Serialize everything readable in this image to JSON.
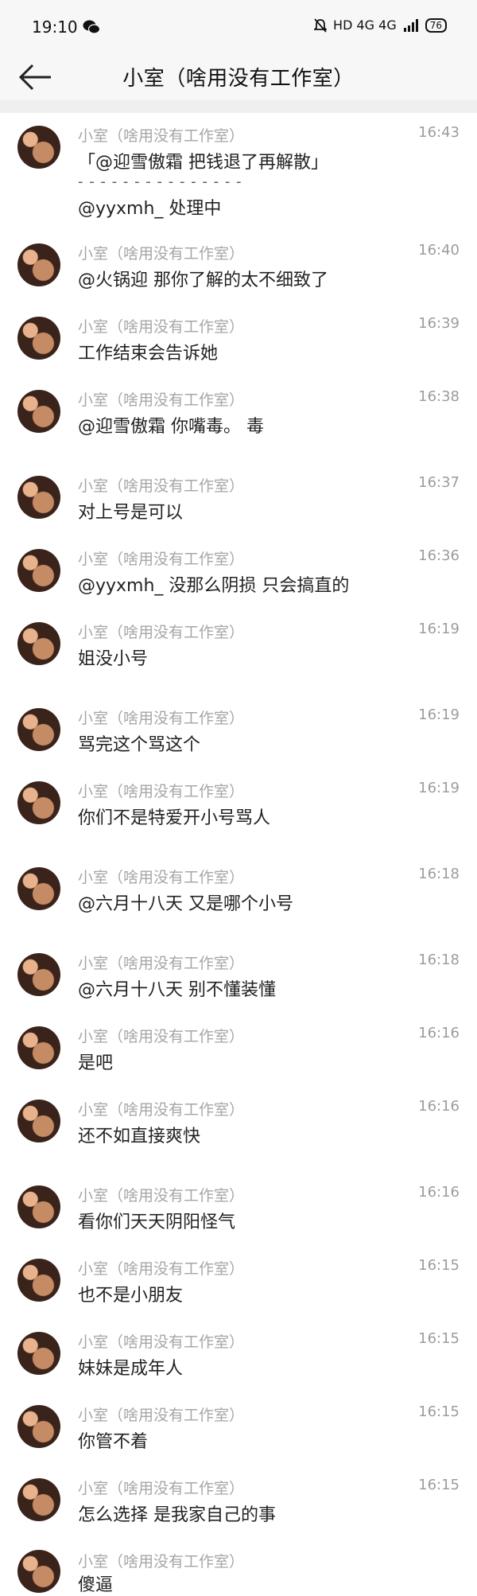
{
  "status": {
    "time": "19:10",
    "network": "HD 4G 4G",
    "battery": "76"
  },
  "nav": {
    "title": "小室（啥用没有工作室）"
  },
  "messages": [
    {
      "name": "小室（啥用没有工作室）",
      "time": "16:43",
      "quote": "「@迎雪傲霜 把钱退了再解散」",
      "divider": "- - - - - - - - - - - - - - -",
      "text": "@yyxmh_ 处理中"
    },
    {
      "name": "小室（啥用没有工作室）",
      "time": "16:40",
      "text": "@火锅迎 那你了解的太不细致了"
    },
    {
      "name": "小室（啥用没有工作室）",
      "time": "16:39",
      "text": "工作结束会告诉她"
    },
    {
      "name": "小室（啥用没有工作室）",
      "time": "16:38",
      "text": "@迎雪傲霜 你嘴毒。 毒"
    },
    {
      "name": "小室（啥用没有工作室）",
      "time": "16:37",
      "text": "对上号是可以"
    },
    {
      "name": "小室（啥用没有工作室）",
      "time": "16:36",
      "text": "@yyxmh_ 没那么阴损 只会搞直的"
    },
    {
      "name": "小室（啥用没有工作室）",
      "time": "16:19",
      "text": "姐没小号"
    },
    {
      "name": "小室（啥用没有工作室）",
      "time": "16:19",
      "text": "骂完这个骂这个"
    },
    {
      "name": "小室（啥用没有工作室）",
      "time": "16:19",
      "text": "你们不是特爱开小号骂人"
    },
    {
      "name": "小室（啥用没有工作室）",
      "time": "16:18",
      "text": "@六月十八天 又是哪个小号"
    },
    {
      "name": "小室（啥用没有工作室）",
      "time": "16:18",
      "text": "@六月十八天 别不懂装懂"
    },
    {
      "name": "小室（啥用没有工作室）",
      "time": "16:16",
      "text": "是吧"
    },
    {
      "name": "小室（啥用没有工作室）",
      "time": "16:16",
      "text": "还不如直接爽快"
    },
    {
      "name": "小室（啥用没有工作室）",
      "time": "16:16",
      "text": "看你们天天阴阳怪气"
    },
    {
      "name": "小室（啥用没有工作室）",
      "time": "16:15",
      "text": "也不是小朋友"
    },
    {
      "name": "小室（啥用没有工作室）",
      "time": "16:15",
      "text": "妹妹是成年人"
    },
    {
      "name": "小室（啥用没有工作室）",
      "time": "16:15",
      "text": "你管不着"
    },
    {
      "name": "小室（啥用没有工作室）",
      "time": "16:15",
      "text": "怎么选择 是我家自己的事"
    },
    {
      "name": "小室（啥用没有工作室）",
      "time": "",
      "text": "傻逼"
    }
  ]
}
